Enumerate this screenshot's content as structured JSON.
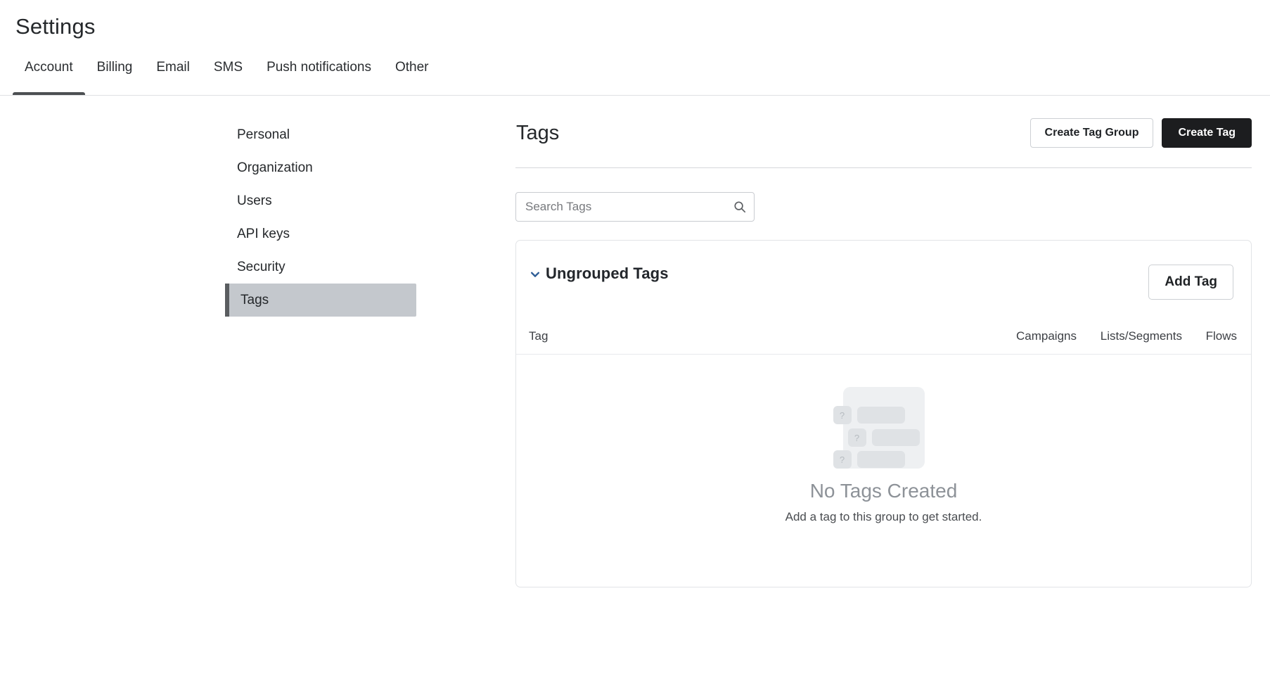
{
  "header": {
    "title": "Settings"
  },
  "tabs": [
    {
      "label": "Account",
      "active": true
    },
    {
      "label": "Billing",
      "active": false
    },
    {
      "label": "Email",
      "active": false
    },
    {
      "label": "SMS",
      "active": false
    },
    {
      "label": "Push notifications",
      "active": false
    },
    {
      "label": "Other",
      "active": false
    }
  ],
  "sidebar": {
    "items": [
      {
        "label": "Personal",
        "selected": false
      },
      {
        "label": "Organization",
        "selected": false
      },
      {
        "label": "Users",
        "selected": false
      },
      {
        "label": "API keys",
        "selected": false
      },
      {
        "label": "Security",
        "selected": false
      },
      {
        "label": "Tags",
        "selected": true
      }
    ]
  },
  "main": {
    "title": "Tags",
    "actions": {
      "create_tag_group_label": "Create Tag Group",
      "create_tag_label": "Create Tag"
    },
    "search": {
      "placeholder": "Search Tags",
      "value": "",
      "icon": "search-icon"
    },
    "group_card": {
      "chevron_icon": "chevron-down-icon",
      "group_title": "Ungrouped Tags",
      "add_tag_label": "Add Tag",
      "columns": {
        "tag": "Tag",
        "campaigns": "Campaigns",
        "lists_segments": "Lists/Segments",
        "flows": "Flows"
      },
      "empty_state": {
        "illustration_badge": "?",
        "title": "No Tags Created",
        "subtitle": "Add a tag to this group to get started."
      }
    }
  },
  "colors": {
    "accent_dark": "#1c1d1f",
    "chevron_blue": "#2e5d96",
    "selected_nav_bg": "#c4c8cd",
    "selected_nav_accent": "#5a5d60",
    "tab_underline": "#4c4f52",
    "empty_title": "#8d9298"
  }
}
